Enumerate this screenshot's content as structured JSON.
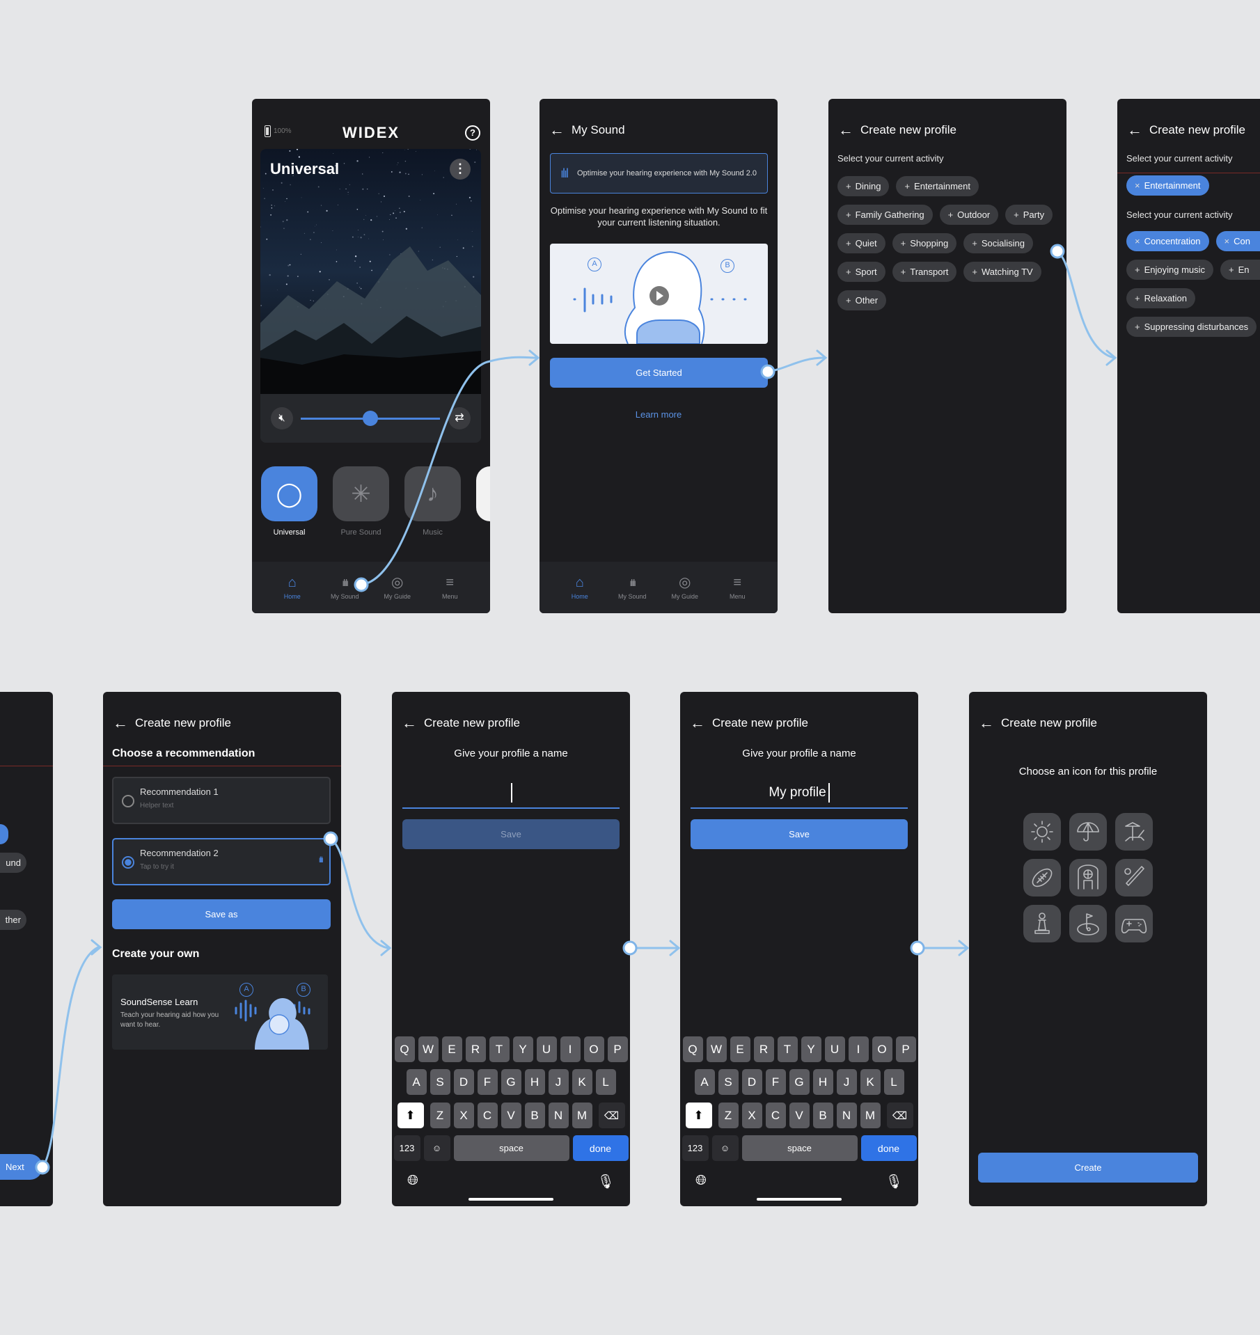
{
  "colors": {
    "background": "#e5e6e8",
    "phone": "#1c1c1f",
    "accent": "#4a84dd",
    "chip": "#3a3b3f",
    "connector": "#8fc1ec"
  },
  "nav": [
    {
      "label": "Home",
      "icon": "home-icon"
    },
    {
      "label": "My Sound",
      "icon": "sound-bars-icon"
    },
    {
      "label": "My Guide",
      "icon": "compass-icon"
    },
    {
      "label": "Menu",
      "icon": "menu-icon"
    }
  ],
  "home": {
    "battery": "100%",
    "logo": "WIDEX",
    "program_title": "Universal",
    "volume_level": 0.5,
    "programs": [
      {
        "label": "Universal",
        "active": true
      },
      {
        "label": "Pure Sound",
        "active": false
      },
      {
        "label": "Music",
        "active": false
      }
    ]
  },
  "my_sound": {
    "title": "My Sound",
    "banner": "Optimise your hearing experience with My Sound 2.0",
    "description": "Optimise your hearing experience with My Sound to fit your current listening situation.",
    "label_a": "A",
    "label_b": "B",
    "get_started": "Get Started",
    "learn_more": "Learn more"
  },
  "activity": {
    "title": "Create new profile",
    "subtitle": "Select your current activity",
    "chips": [
      "Dining",
      "Entertainment",
      "Family Gathering",
      "Outdoor",
      "Party",
      "Quiet",
      "Shopping",
      "Socialising",
      "Sport",
      "Transport",
      "Watching TV",
      "Other"
    ]
  },
  "activity_selected": {
    "title": "Create new profile",
    "subtitle": "Select your current activity",
    "selected": [
      "Entertainment"
    ],
    "subtitle2": "Select your current activity",
    "chips": [
      {
        "label": "Concentration",
        "selected": true
      },
      {
        "label": "Con",
        "selected": true
      },
      {
        "label": "Enjoying music",
        "selected": false
      },
      {
        "label": "En",
        "selected": false
      },
      {
        "label": "Relaxation",
        "selected": false
      },
      {
        "label": "Suppressing disturbances",
        "selected": false
      }
    ]
  },
  "partial": {
    "chip1": "und",
    "chip2": "ther",
    "next": "Next"
  },
  "recommendation": {
    "title": "Create new profile",
    "heading": "Choose a recommendation",
    "options": [
      {
        "label": "Recommendation 1",
        "helper": "Helper text",
        "selected": false
      },
      {
        "label": "Recommendation 2",
        "helper": "Tap to try it",
        "selected": true
      }
    ],
    "save_as": "Save as",
    "create_heading": "Create your own",
    "card_title": "SoundSense Learn",
    "card_text": "Teach your hearing aid how you want to hear.",
    "label_a": "A",
    "label_b": "B"
  },
  "name_empty": {
    "title": "Create new profile",
    "prompt": "Give your profile a name",
    "value": "",
    "save": "Save"
  },
  "name_filled": {
    "title": "Create new profile",
    "prompt": "Give your profile a name",
    "value": "My profile",
    "save": "Save"
  },
  "icon_pick": {
    "title": "Create new profile",
    "prompt": "Choose an icon for this profile",
    "icons": [
      "sun-icon",
      "umbrella-icon",
      "beach-chair-icon",
      "football-icon",
      "basketball-icon",
      "baseball-icon",
      "chess-pawn-icon",
      "golf-icon",
      "gamepad-icon"
    ],
    "create": "Create"
  },
  "keyboard": {
    "rows": [
      [
        "Q",
        "W",
        "E",
        "R",
        "T",
        "Y",
        "U",
        "I",
        "O",
        "P"
      ],
      [
        "A",
        "S",
        "D",
        "F",
        "G",
        "H",
        "J",
        "K",
        "L"
      ],
      [
        "Z",
        "X",
        "C",
        "V",
        "B",
        "N",
        "M"
      ]
    ],
    "numbers": "123",
    "space": "space",
    "done": "done"
  }
}
